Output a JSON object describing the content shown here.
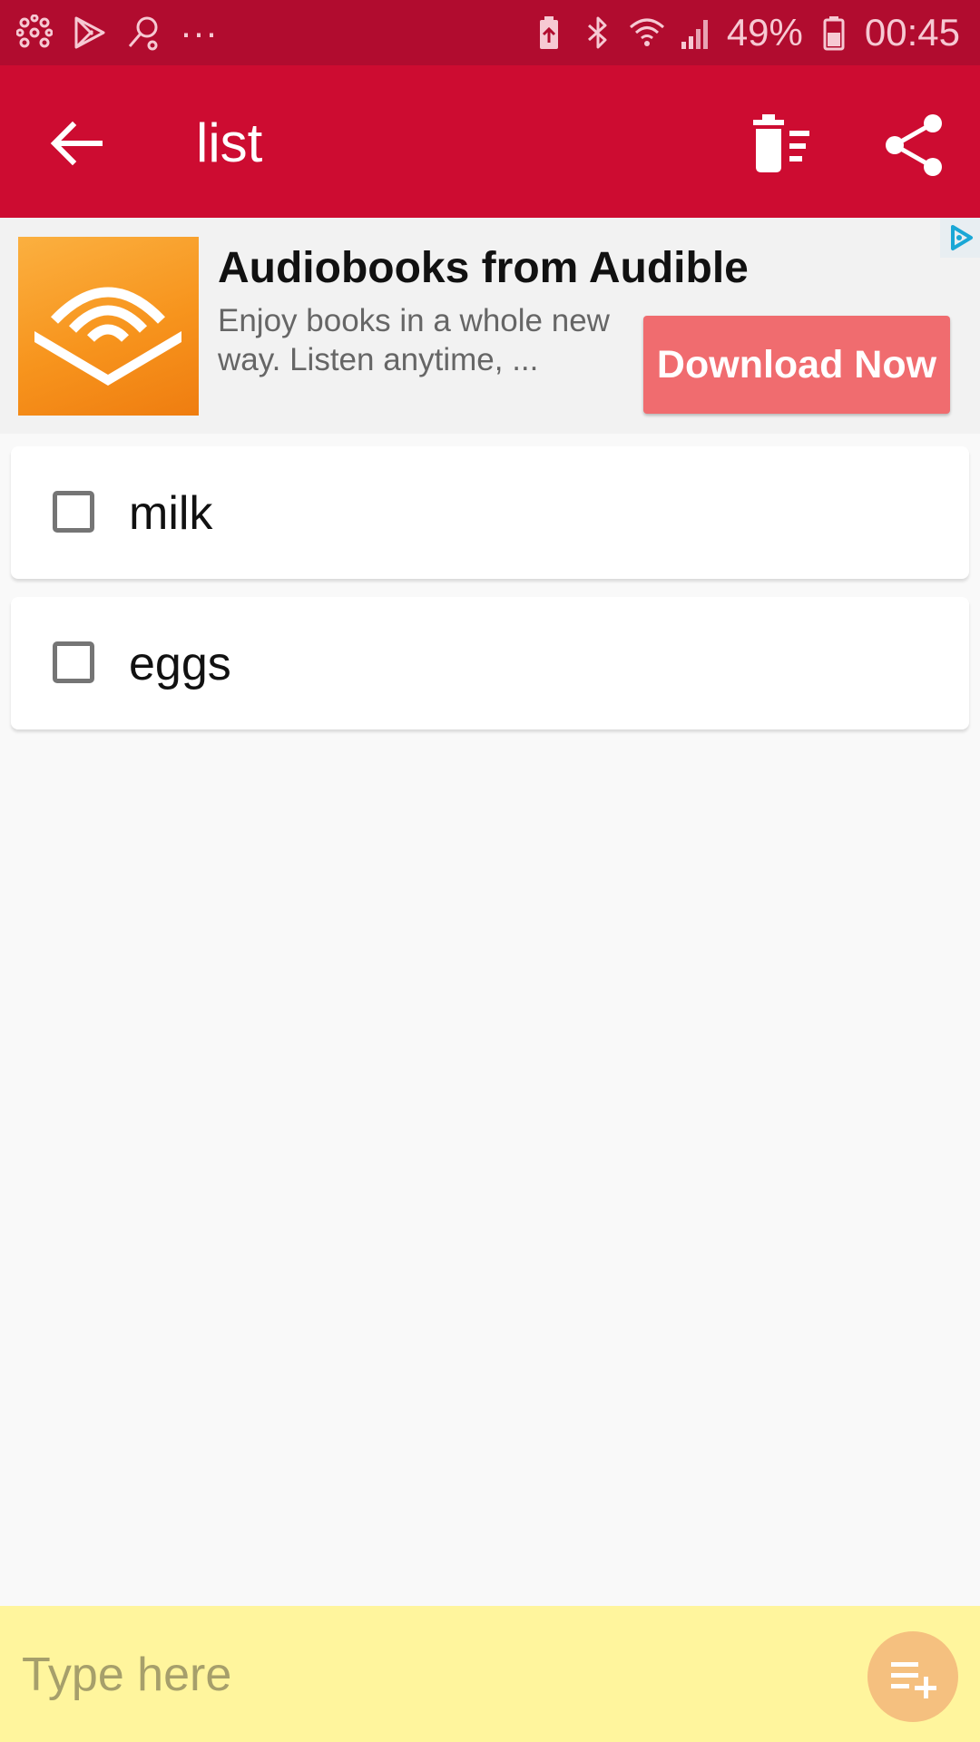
{
  "status_bar": {
    "battery_percent": "49%",
    "time": "00:45",
    "icons": [
      "app-notification-icon",
      "play-store-icon",
      "search-notification-icon",
      "more-notifications-icon",
      "battery-saver-icon",
      "bluetooth-icon",
      "wifi-icon",
      "signal-icon",
      "battery-icon"
    ],
    "more_label": "···"
  },
  "app_bar": {
    "title": "list",
    "icons": [
      "back-arrow-icon",
      "clear-list-icon",
      "share-icon"
    ]
  },
  "ad": {
    "title": "Audiobooks from Audible",
    "description": "Enjoy books in a whole new way. Listen anytime, ...",
    "cta_label": "Download Now",
    "logo_icon": "audible-logo-icon",
    "choice_icon": "ad-choices-icon"
  },
  "items": [
    {
      "label": "milk",
      "checked": false
    },
    {
      "label": "eggs",
      "checked": false
    }
  ],
  "input": {
    "placeholder": "Type here",
    "value": "",
    "add_icon": "playlist-add-icon"
  },
  "colors": {
    "status_bar": "#b10c2f",
    "app_bar": "#cd0c31",
    "cta": "#f06c6f",
    "input_bar": "#fff59d",
    "add_button": "#f5c07f"
  }
}
